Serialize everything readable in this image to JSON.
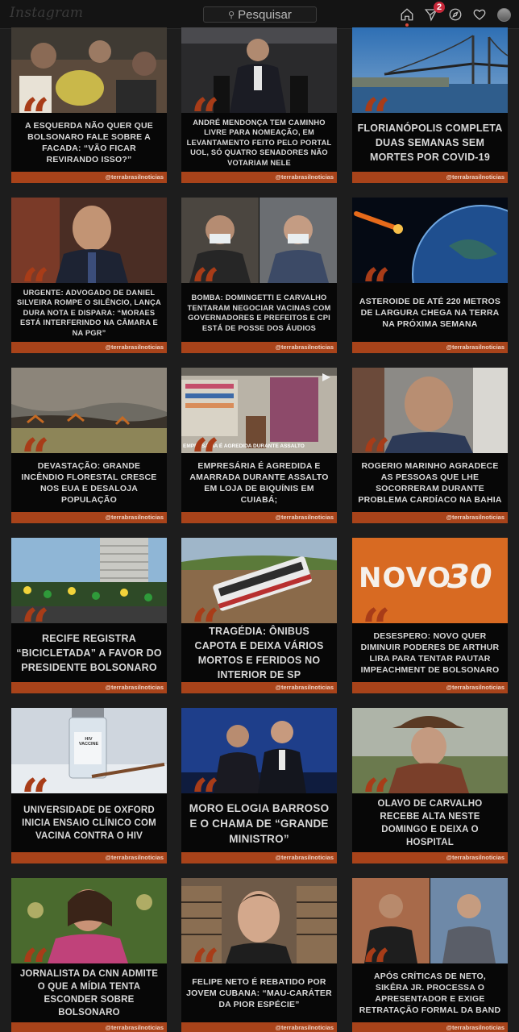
{
  "header": {
    "logo_text": "Instagram",
    "search_placeholder": "Pesquisar",
    "notification_count": "2",
    "icons": [
      "home-icon",
      "direct-icon",
      "explore-icon",
      "heart-icon",
      "avatar"
    ]
  },
  "posts": [
    {
      "title": "A ESQUERDA NÃO QUER QUE BOLSONARO FALE SOBRE A FACADA: “VÃO FICAR REVIRANDO ISSO?”",
      "handle": "@terrabrasilnoticias"
    },
    {
      "title": "ANDRÉ MENDONÇA TEM CAMINHO LIVRE PARA NOMEAÇÃO, EM LEVANTAMENTO FEITO PELO PORTAL UOL, SÓ QUATRO SENADORES NÃO VOTARIAM NELE",
      "handle": "@terrabrasilnoticias"
    },
    {
      "title": "FLORIANÓPOLIS COMPLETA DUAS SEMANAS SEM MORTES POR COVID-19",
      "handle": "@terrabrasilnoticias"
    },
    {
      "title": "URGENTE: ADVOGADO DE DANIEL SILVEIRA ROMPE O SILÊNCIO, LANÇA DURA NOTA E DISPARA: “MORAES ESTÁ INTERFERINDO NA CÂMARA E NA PGR”",
      "handle": "@terrabrasilnoticias"
    },
    {
      "title": "BOMBA: DOMINGETTI E CARVALHO TENTARAM NEGOCIAR VACINAS COM GOVERNADORES E PREFEITOS E CPI ESTÁ DE POSSE DOS ÁUDIOS",
      "handle": "@terrabrasilnoticias"
    },
    {
      "title": "ASTEROIDE DE ATÉ 220 METROS DE LARGURA CHEGA NA TERRA NA PRÓXIMA SEMANA",
      "handle": "@terrabrasilnoticias"
    },
    {
      "title": "DEVASTAÇÃO: GRANDE INCÊNDIO FLORESTAL CRESCE NOS EUA E DESALOJA POPULAÇÃO",
      "handle": "@terrabrasilnoticias"
    },
    {
      "title": "EMPRESÁRIA É AGREDIDA E AMARRADA DURANTE ASSALTO EM LOJA DE BIQUÍNIS EM CUIABÁ;",
      "handle": "@terrabrasilnoticias",
      "overlay": "EMPRESÁRIA É AGREDIDA DURANTE ASSALTO"
    },
    {
      "title": "ROGERIO MARINHO AGRADECE AS PESSOAS QUE LHE SOCORRERAM DURANTE PROBLEMA CARDÍACO NA BAHIA",
      "handle": "@terrabrasilnoticias"
    },
    {
      "title": "RECIFE REGISTRA “BICICLETADA” A FAVOR DO PRESIDENTE BOLSONARO",
      "handle": "@terrabrasilnoticias"
    },
    {
      "title": "TRAGÉDIA: ÔNIBUS CAPOTA E DEIXA VÁRIOS MORTOS E FERIDOS NO INTERIOR DE SP",
      "handle": "@terrabrasilnoticias"
    },
    {
      "title": "DESESPERO: NOVO QUER DIMINUIR PODERES DE ARTHUR LIRA PARA TENTAR PAUTAR IMPEACHMENT DE BOLSONARO",
      "handle": "@terrabrasilnoticias",
      "logo_text": "NOVO",
      "logo_num": "30"
    },
    {
      "title": "UNIVERSIDADE DE OXFORD INICIA ENSAIO CLÍNICO COM VACINA CONTRA O HIV",
      "handle": "@terrabrasilnoticias",
      "vial_text": "HIV VACCINE"
    },
    {
      "title": "MORO ELOGIA BARROSO E O CHAMA DE “GRANDE MINISTRO”",
      "handle": "@terrabrasilnoticias"
    },
    {
      "title": "OLAVO DE CARVALHO RECEBE ALTA NESTE DOMINGO E DEIXA O HOSPITAL",
      "handle": "@terrabrasilnoticias"
    },
    {
      "title": "JORNALISTA DA CNN ADMITE O QUE A MÍDIA TENTA ESCONDER SOBRE BOLSONARO",
      "handle": "@terrabrasilnoticias"
    },
    {
      "title": "FELIPE NETO É REBATIDO POR JOVEM CUBANA: “MAU-CARÁTER DA PIOR ESPÉCIE”",
      "handle": "@terrabrasilnoticias"
    },
    {
      "title": "APÓS CRÍTICAS DE NETO, SIKÊRA JR. PROCESSA O APRESENTADOR E EXIGE RETRATAÇÃO FORMAL DA BAND",
      "handle": "@terrabrasilnoticias"
    }
  ],
  "colors": {
    "accent": "#a8431a",
    "background": "#1d1d1d",
    "notification": "#c8283a"
  }
}
